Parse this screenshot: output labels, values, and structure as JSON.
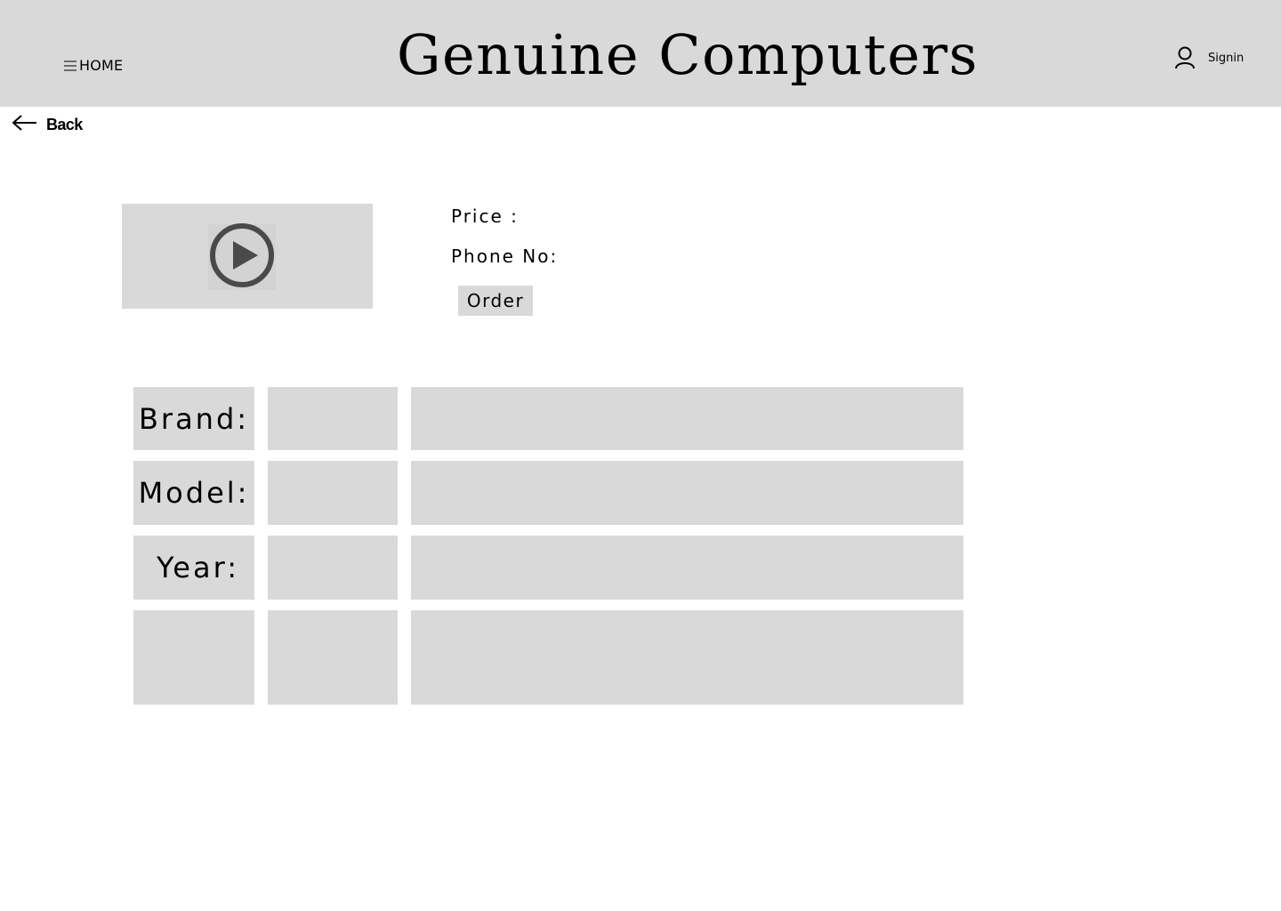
{
  "header": {
    "nav_label": "HOME",
    "site_title": "Genuine Computers",
    "signin_label": "Signin"
  },
  "back": {
    "label": "Back"
  },
  "product": {
    "price_label": "Price :",
    "phone_label": "Phone No:",
    "order_label": "Order"
  },
  "specs": {
    "rows": [
      {
        "label": "Brand:",
        "value": "",
        "detail": ""
      },
      {
        "label": "Model:",
        "value": "",
        "detail": ""
      },
      {
        "label": "Year:",
        "value": "",
        "detail": ""
      },
      {
        "label": "",
        "value": "",
        "detail": ""
      }
    ]
  },
  "icons": {
    "menu": "hamburger-icon",
    "user": "user-icon",
    "back": "arrow-left-icon",
    "play": "play-circle-icon"
  },
  "colors": {
    "header_bg": "#d9d9d9",
    "cell_bg": "#d9d9d9",
    "play_icon": "#4a4a4a"
  }
}
